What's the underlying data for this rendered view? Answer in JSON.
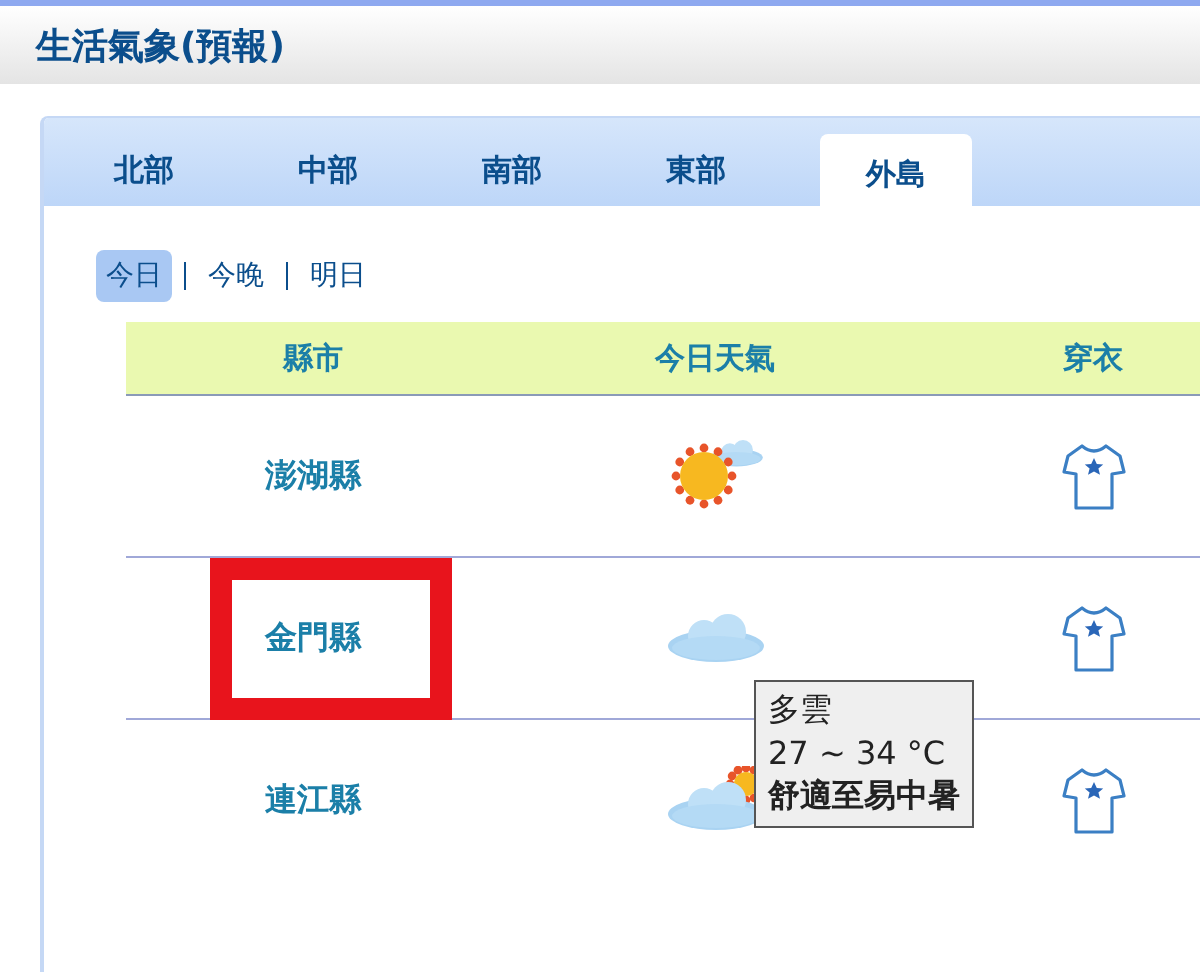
{
  "page": {
    "title": "生活氣象(預報)"
  },
  "tabs": [
    {
      "label": "北部",
      "selected": false
    },
    {
      "label": "中部",
      "selected": false
    },
    {
      "label": "南部",
      "selected": false
    },
    {
      "label": "東部",
      "selected": false
    },
    {
      "label": "外島",
      "selected": true
    }
  ],
  "periods": [
    {
      "label": "今日",
      "selected": true
    },
    {
      "label": "今晚",
      "selected": false
    },
    {
      "label": "明日",
      "selected": false
    }
  ],
  "table": {
    "columns": [
      "縣市",
      "今日天氣",
      "穿衣"
    ],
    "rows": [
      {
        "county": "澎湖縣",
        "kind": "sun-cloud",
        "highlighted": false
      },
      {
        "county": "金門縣",
        "kind": "cloudy",
        "highlighted": true,
        "tooltip": [
          "多雲",
          "27 ~ 34 °C",
          "舒適至易中暑"
        ]
      },
      {
        "county": "連江縣",
        "kind": "cloud-sun",
        "highlighted": false
      }
    ]
  }
}
